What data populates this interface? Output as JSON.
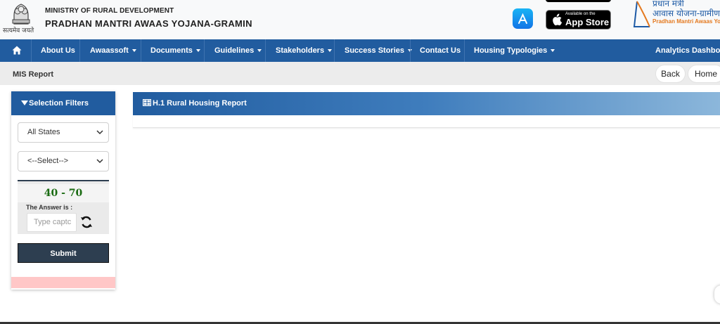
{
  "header": {
    "emblem_motto": "सत्यमेव जयते",
    "ministry": "MINISTRY OF RURAL DEVELOPMENT",
    "scheme": "PRADHAN MANTRI AWAAS YOJANA-GRAMIN",
    "app_store_icon": "app-store-icon",
    "store_badge_small": "Available on the",
    "store_badge_big": "App Store",
    "pmay_line1": "प्रधान मंत्री",
    "pmay_line2": "आवास योजना-ग्रामीण",
    "pmay_line3": "Pradhan Mantri Awaas Yojana-Gramin"
  },
  "nav": {
    "home_icon": "home-icon",
    "items": [
      "About Us",
      "Awaassoft",
      "Documents",
      "Guidelines",
      "Stakeholders",
      "Success Stories",
      "Contact Us",
      "Housing Typologies",
      "Analytics Dashboard"
    ]
  },
  "breadcrumb": {
    "title": "MIS Report",
    "back": "Back",
    "home": "Home"
  },
  "filters": {
    "title": "Selection Filters",
    "state_select": "All States",
    "second_select": "<--Select-->",
    "captcha_question": "40 - 70",
    "answer_label": "The Answer is :",
    "captcha_placeholder": "Type captc",
    "submit": "Submit"
  },
  "report": {
    "title": "H.1 Rural Housing Report"
  },
  "colors": {
    "nav_bg": "#215c9f",
    "panel_dark": "#2d3e50",
    "captcha_green": "#1a6b12",
    "alert_pink": "#ffc7c7"
  }
}
